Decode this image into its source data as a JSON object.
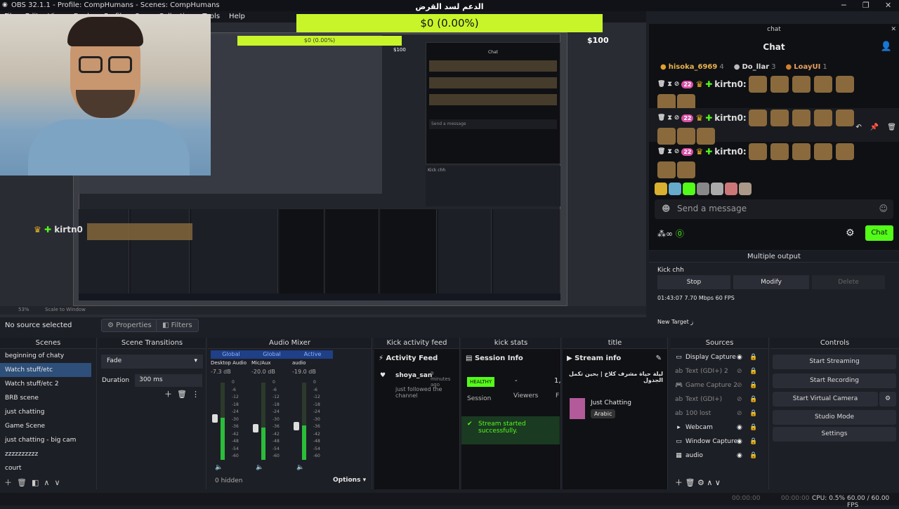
{
  "titlebar": {
    "title": "OBS 32.1.1 - Profile: CompHumans - Scenes: CompHumans"
  },
  "menu": [
    "File",
    "Edit",
    "View",
    "Docks",
    "Profile",
    "Scene Collection",
    "Tools",
    "Help"
  ],
  "goal": {
    "heading": "الدعم لسد القرض",
    "value": "$0 (0.00%)",
    "max": "$100"
  },
  "preview": {
    "nested_overlay_value": "$0 (0.00%)",
    "nested_max": "$100",
    "overlay_user": "kirtn0"
  },
  "toolbar": {
    "no_source": "No source selected",
    "properties": "Properties",
    "filters": "Filters"
  },
  "scenes": {
    "title": "Scenes",
    "items": [
      "beginning of chaty",
      "Watch stuff/etc",
      "Watch stuff/etc 2",
      "BRB scene",
      "just chatting",
      "Game Scene",
      "just chatting - big cam",
      "zzzzzzzzzz",
      "court"
    ],
    "selected_index": 1
  },
  "transitions": {
    "title": "Scene Transitions",
    "type": "Fade",
    "duration_label": "Duration",
    "duration": "300 ms"
  },
  "audio": {
    "title": "Audio Mixer",
    "channels": [
      {
        "tag": "Global",
        "name": "Desktop Audio",
        "db": "-7.3 dB",
        "level": 0.55
      },
      {
        "tag": "Global",
        "name": "Mic/Aux",
        "db": "-20.0 dB",
        "level": 0.42
      },
      {
        "tag": "Active",
        "name": "audio",
        "db": "-19.0 dB",
        "level": 0.45
      }
    ],
    "scale": [
      "0",
      "-6",
      "-12",
      "-18",
      "-24",
      "-30",
      "-36",
      "-42",
      "-48",
      "-54",
      "-60"
    ],
    "hidden": "0 hidden",
    "options": "Options"
  },
  "activity": {
    "title": "Kick activity feed",
    "header": "Activity Feed",
    "user": "shoya_san",
    "time": "9 minutes ago",
    "text": "just followed the channel"
  },
  "stats": {
    "title": "kick stats",
    "header": "Session Info",
    "badge": "HEALTHY",
    "session": "Session",
    "viewers_value": "-",
    "viewers": "Viewers",
    "extra": "1,",
    "extra2": "F",
    "started": "Stream started successfully."
  },
  "title_panel": {
    "title": "title",
    "header": "Stream info",
    "stream_title": "ليلة حياة مشرف كلاخ | بحين تكمل الجدول",
    "category": "Just Chatting",
    "language": "Arabic"
  },
  "sources": {
    "title": "Sources",
    "items": [
      {
        "icon": "display-icon",
        "glyph": "▭",
        "name": "Display Capture",
        "visible": true,
        "dim": false
      },
      {
        "icon": "text-icon",
        "glyph": "ab",
        "name": "Text (GDI+) 2",
        "visible": false,
        "dim": true
      },
      {
        "icon": "gamepad-icon",
        "glyph": "🎮",
        "name": "Game Capture 2",
        "visible": false,
        "dim": true
      },
      {
        "icon": "text-icon",
        "glyph": "ab",
        "name": "Text (GDI+)",
        "visible": false,
        "dim": true
      },
      {
        "icon": "text-icon",
        "glyph": "ab",
        "name": "100 lost",
        "visible": false,
        "dim": true
      },
      {
        "icon": "folder-icon",
        "glyph": "▸",
        "name": "Webcam",
        "visible": true,
        "dim": false
      },
      {
        "icon": "window-icon",
        "glyph": "▭",
        "name": "Window Capture",
        "visible": true,
        "dim": false
      },
      {
        "icon": "audio-icon",
        "glyph": "▦",
        "name": "audio",
        "visible": true,
        "dim": false
      }
    ]
  },
  "controls": {
    "title": "Controls",
    "start_streaming": "Start Streaming",
    "start_recording": "Start Recording",
    "start_virtual_camera": "Start Virtual Camera",
    "studio_mode": "Studio Mode",
    "settings": "Settings"
  },
  "chat": {
    "window": "chat",
    "header": "Chat",
    "top": [
      {
        "name": "hisoka_6969",
        "rank": "4"
      },
      {
        "name": "Do_llar",
        "rank": "3"
      },
      {
        "name": "LoayUI",
        "rank": "1"
      }
    ],
    "badge_num": "22",
    "messages": [
      {
        "user": "kirtn0:"
      },
      {
        "user": "kirtn0:"
      },
      {
        "user": "kirtn0:"
      }
    ],
    "placeholder": "Send a message",
    "send": "Chat"
  },
  "multi": {
    "title": "Multiple output",
    "target": "Kick chh",
    "stop": "Stop",
    "modify": "Modify",
    "delete": "Delete",
    "stats": "01:43:07  7.70 Mbps  60 FPS",
    "new_target": "New Target ﺯ"
  },
  "status": {
    "time1": "00:00:00",
    "time2": "00:00:00",
    "cpu": "CPU: 0.5%",
    "fps": "60.00 / 60.00 FPS",
    "zoom": "53%",
    "scale": "Scale to Window"
  }
}
